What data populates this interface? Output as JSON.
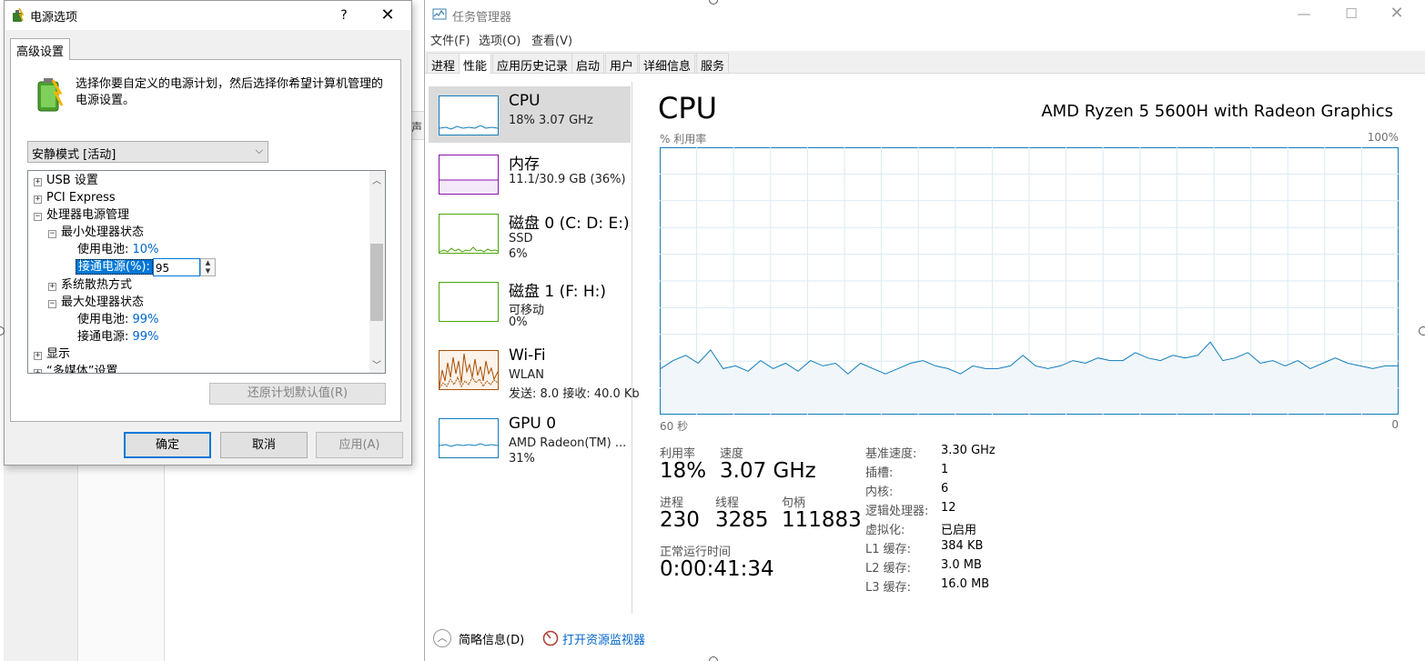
{
  "power_dialog": {
    "title": "电源选项",
    "help": "?",
    "close": "✕",
    "tab": "高级设置",
    "description": "选择你要自定义的电源计划，然后选择你希望计算机管理的电源设置。",
    "plan_select": "安静模式 [活动]",
    "tree": {
      "usb": "USB 设置",
      "pci": "PCI Express",
      "cpu_power": "处理器电源管理",
      "min_state": "最小处理器状态",
      "min_battery_label": "使用电池:",
      "min_battery_value": "10%",
      "min_plugged_label": "接通电源(%):",
      "min_plugged_value": "95",
      "cooling": "系统散热方式",
      "max_state": "最大处理器状态",
      "max_battery_label": "使用电池:",
      "max_battery_value": "99%",
      "max_plugged_label": "接通电源:",
      "max_plugged_value": "99%",
      "display": "显示",
      "multimedia": "“多媒体”设置"
    },
    "restore_button": "还原计划默认值(R)",
    "ok": "确定",
    "cancel": "取消",
    "apply": "应用(A)"
  },
  "bg_fragment": "声",
  "task_manager": {
    "title": "任务管理器",
    "minimize": "—",
    "maximize": "☐",
    "close": "✕",
    "menus": [
      "文件(F)",
      "选项(O)",
      "查看(V)"
    ],
    "tabs": [
      "进程",
      "性能",
      "应用历史记录",
      "启动",
      "用户",
      "详细信息",
      "服务"
    ],
    "active_tab": "性能",
    "sidebar": [
      {
        "name": "CPU",
        "line1": "18% 3.07 GHz",
        "line2": "",
        "color": "#117dbb"
      },
      {
        "name": "内存",
        "line1": "11.1/30.9 GB (36%)",
        "line2": "",
        "color": "#8b12ae"
      },
      {
        "name": "磁盘 0 (C: D: E:)",
        "line1": "SSD",
        "line2": "6%",
        "color": "#4da60c"
      },
      {
        "name": "磁盘 1 (F: H:)",
        "line1": "可移动",
        "line2": "0%",
        "color": "#4da60c"
      },
      {
        "name": "Wi-Fi",
        "line1": "WLAN",
        "line2": "发送: 8.0 接收: 40.0 Kb",
        "color": "#a74f01"
      },
      {
        "name": "GPU 0",
        "line1": "AMD Radeon(TM) ...",
        "line2": "31%",
        "color": "#117dbb"
      }
    ],
    "main": {
      "heading": "CPU",
      "model": "AMD Ryzen 5 5600H with Radeon Graphics",
      "util_label": "% 利用率",
      "util_max": "100%",
      "axis_left": "60 秒",
      "axis_right": "0",
      "stats": {
        "utilization_label": "利用率",
        "utilization_value": "18%",
        "speed_label": "速度",
        "speed_value": "3.07 GHz",
        "processes_label": "进程",
        "processes_value": "230",
        "threads_label": "线程",
        "threads_value": "3285",
        "handles_label": "句柄",
        "handles_value": "111883",
        "uptime_label": "正常运行时间",
        "uptime_value": "0:00:41:34"
      },
      "info": [
        {
          "key": "基准速度:",
          "value": "3.30 GHz"
        },
        {
          "key": "插槽:",
          "value": "1"
        },
        {
          "key": "内核:",
          "value": "6"
        },
        {
          "key": "逻辑处理器:",
          "value": "12"
        },
        {
          "key": "虚拟化:",
          "value": "已启用"
        },
        {
          "key": "L1 缓存:",
          "value": "384 KB"
        },
        {
          "key": "L2 缓存:",
          "value": "3.0 MB"
        },
        {
          "key": "L3 缓存:",
          "value": "16.0 MB"
        }
      ]
    },
    "footer": {
      "brief": "简略信息(D)",
      "monitor": "打开资源监视器"
    }
  },
  "chart_data": {
    "type": "area",
    "ylim": [
      0,
      100
    ],
    "xlim": [
      60,
      0
    ],
    "xlabel": "60 秒",
    "ylabel": "% 利用率",
    "grid": true,
    "color": "#117dbb",
    "fill": "#f1f6fa",
    "values": [
      17,
      20,
      22,
      19,
      24,
      17,
      18,
      16,
      20,
      17,
      19,
      16,
      20,
      18,
      19,
      15,
      19,
      17,
      15,
      17,
      19,
      20,
      18,
      17,
      15,
      18,
      17,
      17,
      18,
      22,
      18,
      17,
      18,
      20,
      19,
      21,
      20,
      20,
      23,
      21,
      20,
      22,
      21,
      22,
      27,
      20,
      21,
      23,
      19,
      20,
      18,
      20,
      17,
      19,
      21,
      19,
      18,
      17,
      18,
      18
    ]
  }
}
